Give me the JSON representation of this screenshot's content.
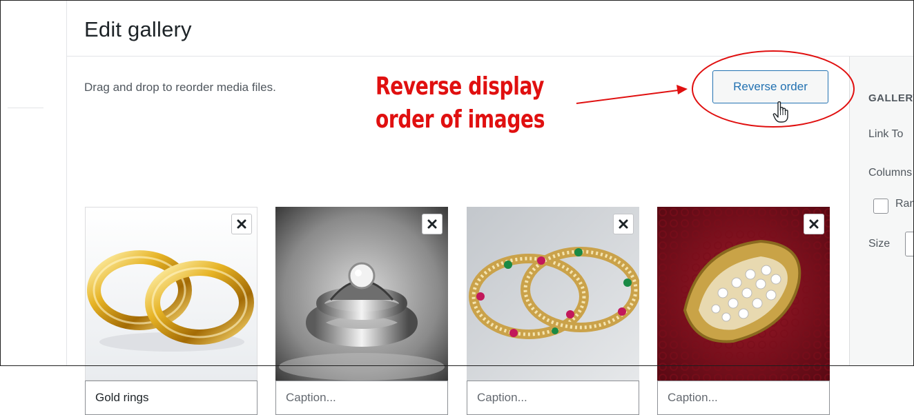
{
  "header": {
    "title": "Edit gallery"
  },
  "content": {
    "instructions": "Drag and drop to reorder media files.",
    "reverse_button_label": "Reverse order"
  },
  "annotation": {
    "line1": "Reverse display",
    "line2": "order of images",
    "color": "#e01010"
  },
  "sidebar": {
    "heading": "GALLERY SETTINGS",
    "link_to_label": "Link To",
    "columns_label": "Columns",
    "random_label": "Random Order",
    "size_label": "Size"
  },
  "gallery": {
    "items": [
      {
        "caption_value": "Gold rings",
        "caption_placeholder": "Caption...",
        "image_icon": "gold-rings-image"
      },
      {
        "caption_value": "",
        "caption_placeholder": "Caption...",
        "image_icon": "silver-ring-image"
      },
      {
        "caption_value": "",
        "caption_placeholder": "Caption...",
        "image_icon": "bangles-image"
      },
      {
        "caption_value": "",
        "caption_placeholder": "Caption...",
        "image_icon": "diamond-ring-image"
      }
    ],
    "remove_icon": "close-icon"
  },
  "colors": {
    "accent": "#2271b1",
    "annotation_red": "#e01010"
  }
}
